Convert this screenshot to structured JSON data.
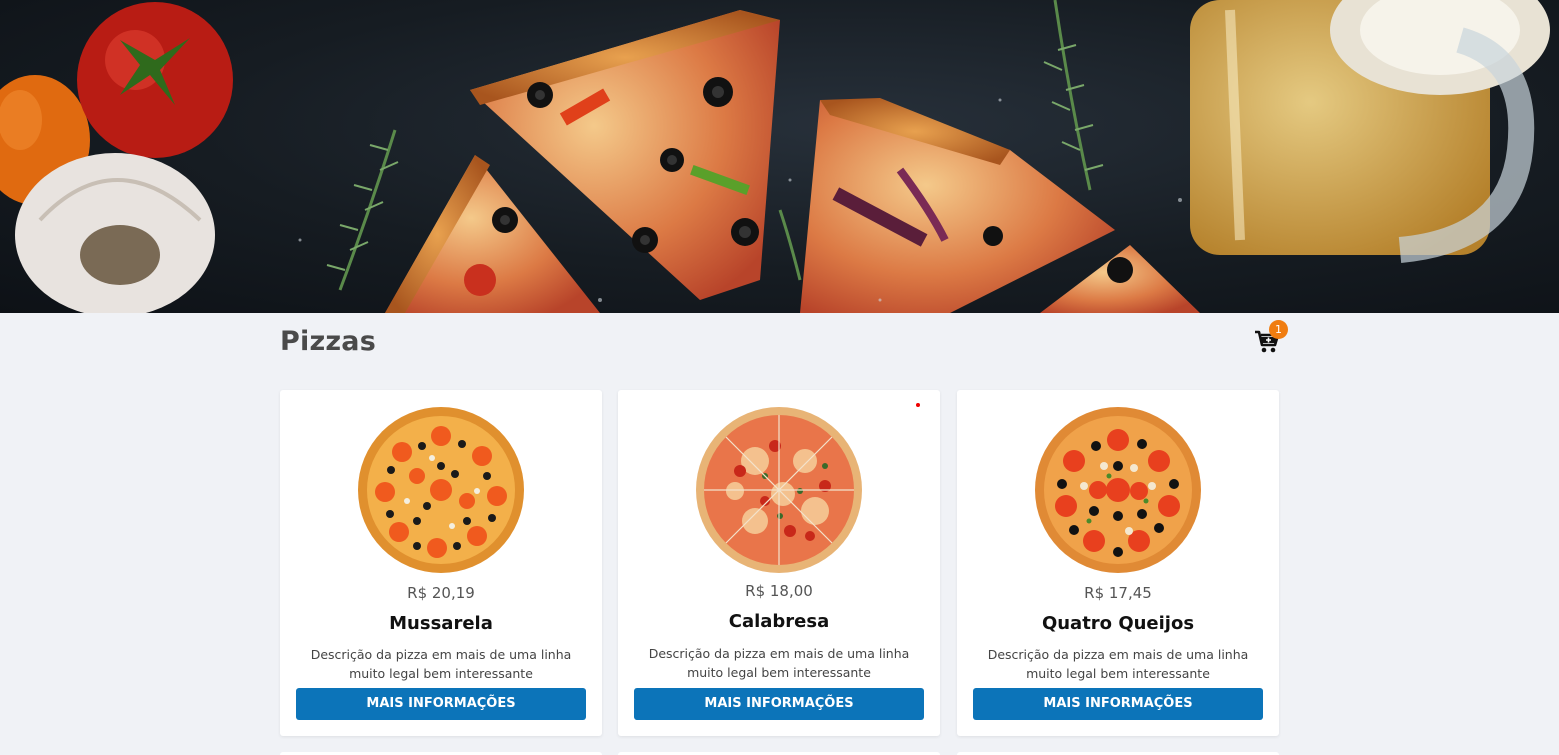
{
  "header": {
    "title": "Pizzas",
    "cart_count": "1",
    "cart_icon": "cart-plus-icon"
  },
  "pizzas": [
    {
      "price": "R$ 20,19",
      "name": "Mussarela",
      "description": "Descrição da pizza em mais de uma linha muito legal bem interessante",
      "button_label": "MAIS INFORMAÇÕES"
    },
    {
      "price": "R$ 18,00",
      "name": "Calabresa",
      "description": "Descrição da pizza em mais de uma linha muito legal bem interessante",
      "button_label": "MAIS INFORMAÇÕES"
    },
    {
      "price": "R$ 17,45",
      "name": "Quatro Queijos",
      "description": "Descrição da pizza em mais de uma linha muito legal bem interessante",
      "button_label": "MAIS INFORMAÇÕES"
    }
  ],
  "colors": {
    "accent": "#0c74b9",
    "badge": "#f07d10",
    "background": "#f0f2f6"
  }
}
